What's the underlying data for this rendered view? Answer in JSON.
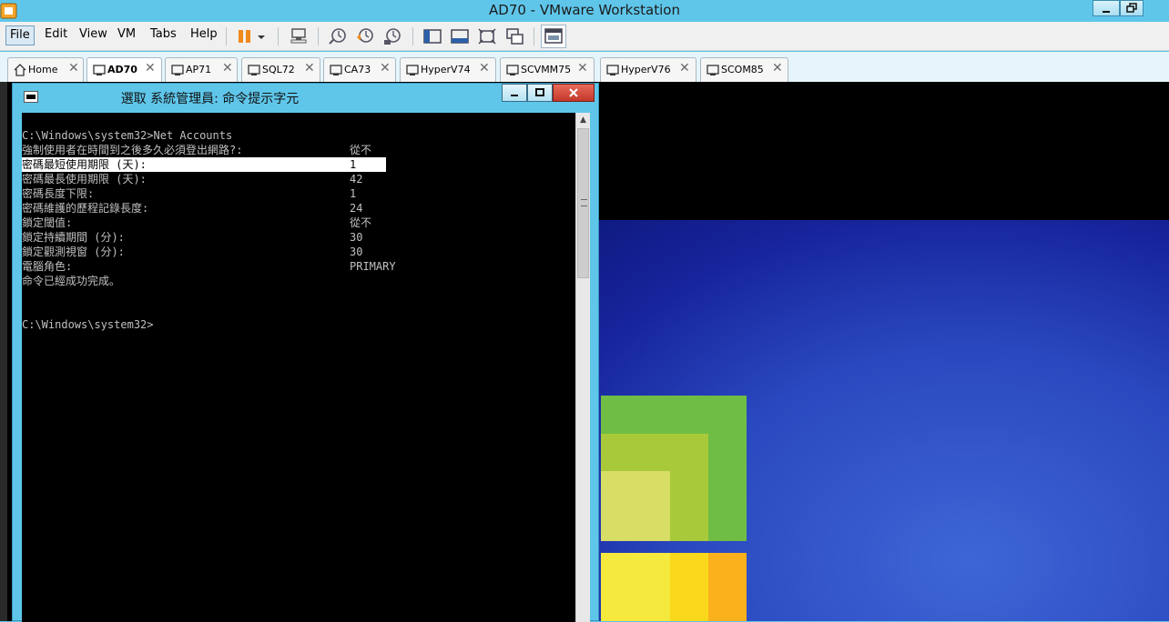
{
  "window": {
    "title": "AD70 - VMware Workstation"
  },
  "menu": {
    "file": "File",
    "edit": "Edit",
    "view": "View",
    "vm": "VM",
    "tabs": "Tabs",
    "help": "Help"
  },
  "tabs": [
    {
      "label": "Home"
    },
    {
      "label": "AD70"
    },
    {
      "label": "AP71"
    },
    {
      "label": "SQL72"
    },
    {
      "label": "CA73"
    },
    {
      "label": "HyperV74"
    },
    {
      "label": "SCVMM75"
    },
    {
      "label": "HyperV76"
    },
    {
      "label": "SCOM85"
    }
  ],
  "cmd": {
    "title": "選取 系統管理員: 命令提示字元",
    "prompt_cmd": "C:\\Windows\\system32>Net Accounts",
    "rows": [
      {
        "label": "強制使用者在時間到之後多久必須登出網路?:",
        "value": "從不"
      },
      {
        "label": "密碼最短使用期限 (天):",
        "value": "1"
      },
      {
        "label": "密碼最長使用期限 (天):",
        "value": "42"
      },
      {
        "label": "密碼長度下限:",
        "value": "1"
      },
      {
        "label": "密碼維護的歷程記錄長度:",
        "value": "24"
      },
      {
        "label": "鎖定閾值:",
        "value": "從不"
      },
      {
        "label": "鎖定持續期間 (分):",
        "value": "30"
      },
      {
        "label": "鎖定觀測視窗 (分):",
        "value": "30"
      },
      {
        "label": "電腦角色:",
        "value": "PRIMARY"
      }
    ],
    "done": "命令已經成功完成。",
    "prompt": "C:\\Windows\\system32>"
  },
  "colors": {
    "accent": "#5fc6ea",
    "console_bg": "#000000",
    "desktop_blue": "#2a48bf"
  }
}
